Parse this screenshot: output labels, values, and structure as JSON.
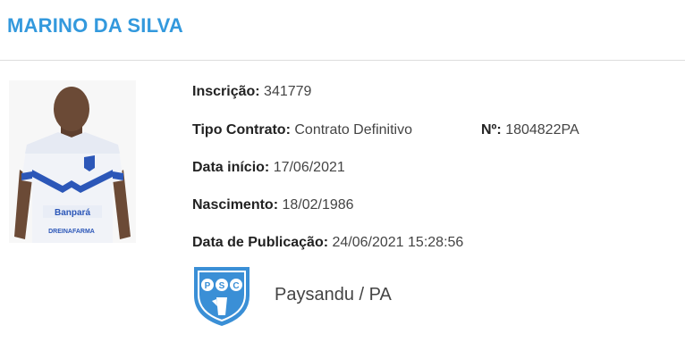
{
  "header": {
    "player_name": "MARINO DA SILVA"
  },
  "details": {
    "inscricao_label": "Inscrição:",
    "inscricao_value": "341779",
    "tipo_contrato_label": "Tipo Contrato:",
    "tipo_contrato_value": "Contrato Definitivo",
    "numero_label": "Nº:",
    "numero_value": "1804822PA",
    "data_inicio_label": "Data início:",
    "data_inicio_value": "17/06/2021",
    "nascimento_label": "Nascimento:",
    "nascimento_value": "18/02/1986",
    "data_publicacao_label": "Data de Publicação:",
    "data_publicacao_value": "24/06/2021 15:28:56"
  },
  "photo": {
    "jersey_sponsor": "Banpará",
    "jersey_sponsor2": "DREINAFARMA"
  },
  "club": {
    "name": "Paysandu / PA",
    "logo_letters": [
      "P",
      "S",
      "C"
    ],
    "logo_color": "#3a8fd6"
  },
  "colors": {
    "title": "#3399dd",
    "divider": "#dddddd"
  }
}
